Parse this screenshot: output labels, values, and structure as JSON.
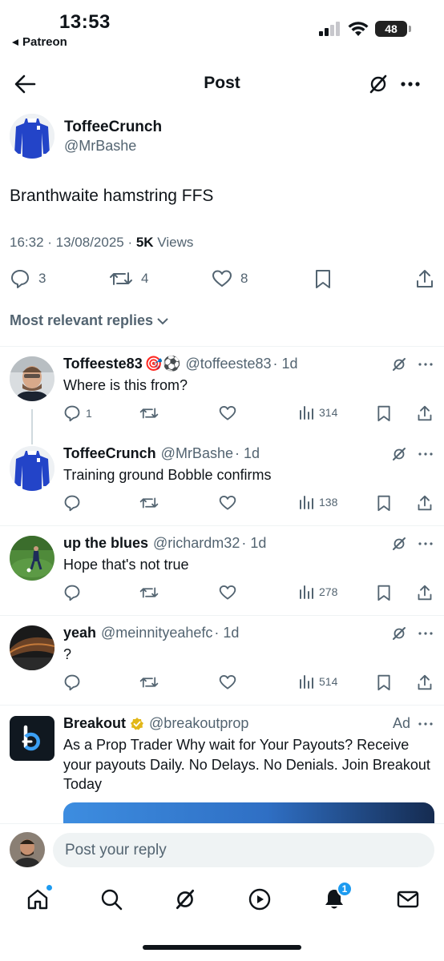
{
  "status_bar": {
    "time": "13:53",
    "back_app": "Patreon",
    "battery": "48"
  },
  "header": {
    "title": "Post"
  },
  "post": {
    "author_name": "ToffeeCrunch",
    "author_handle": "@MrBashe",
    "text": "Branthwaite hamstring FFS",
    "timestamp": "16:32 · 13/08/2025 · ",
    "views_count": "5K",
    "views_label": " Views",
    "replies": "3",
    "reposts": "4",
    "likes": "8"
  },
  "sort_label": "Most relevant replies",
  "replies": [
    {
      "name": "Toffeeste83",
      "emoji": "🎯⚽",
      "handle": "@toffeeste83",
      "age": "· 1d",
      "text": "Where is this from?",
      "reply_count": "1",
      "views": "314"
    },
    {
      "name": "ToffeeCrunch",
      "emoji": "",
      "handle": "@MrBashe",
      "age": "· 1d",
      "text": "Training ground Bobble confirms",
      "reply_count": "",
      "views": "138"
    },
    {
      "name": "up the blues",
      "emoji": "",
      "handle": "@richardm32",
      "age": "· 1d",
      "text": "Hope that's not true",
      "reply_count": "",
      "views": "278"
    },
    {
      "name": "yeah",
      "emoji": "",
      "handle": "@meinnityeahefc",
      "age": "· 1d",
      "text": "?",
      "reply_count": "",
      "views": "514"
    }
  ],
  "ad": {
    "name": "Breakout",
    "handle": "@breakoutprop",
    "label": "Ad",
    "text": "As a Prop Trader Why wait for Your Payouts? Receive your payouts Daily. No Delays. No Denials. Join Breakout Today"
  },
  "composer": {
    "placeholder": "Post your reply"
  },
  "tabbar": {
    "notifications_badge": "1"
  },
  "colors": {
    "accent": "#1d9bf0",
    "secondary_text": "#536471",
    "primary_text": "#0f1419",
    "verified_gold": "#e2b719"
  }
}
